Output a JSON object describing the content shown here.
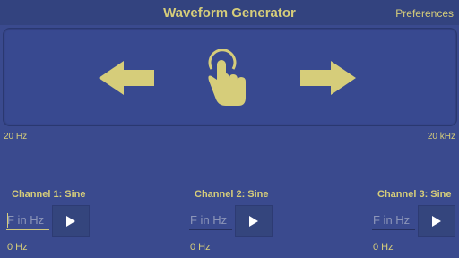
{
  "app": {
    "title": "Waveform Generator",
    "preferences_label": "Preferences"
  },
  "panel": {
    "left_arrow_icon": "left-arrow-icon",
    "touch_icon": "touch-hand-icon",
    "right_arrow_icon": "right-arrow-icon"
  },
  "range": {
    "min_label": "20 Hz",
    "max_label": "20 kHz"
  },
  "channels": [
    {
      "label": "Channel 1: Sine",
      "placeholder": "F in Hz",
      "frequency_readout": "0 Hz",
      "focused": true
    },
    {
      "label": "Channel 2: Sine",
      "placeholder": "F in Hz",
      "frequency_readout": "0 Hz",
      "focused": false
    },
    {
      "label": "Channel 3: Sine",
      "placeholder": "F in Hz",
      "frequency_readout": "0 Hz",
      "focused": false
    }
  ],
  "colors": {
    "background": "#3a4a8e",
    "accent": "#d6cd7a",
    "button": "#34457d"
  }
}
